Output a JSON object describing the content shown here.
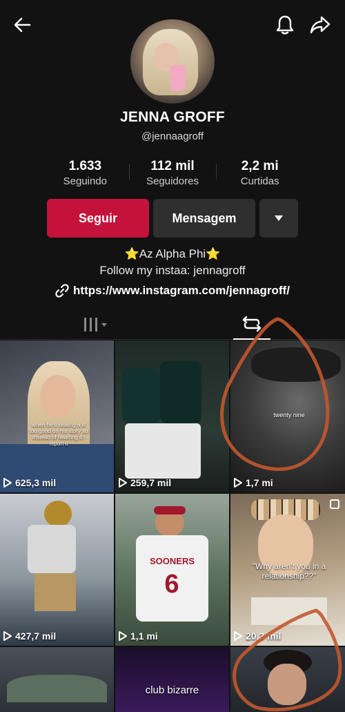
{
  "header": {
    "back_icon": "arrow-left-icon",
    "bell_icon": "bell-icon",
    "share_icon": "share-icon"
  },
  "profile": {
    "display_name": "JENNA GROFF",
    "username": "@jennaagroff",
    "stats": [
      {
        "value": "1.633",
        "label": "Seguindo"
      },
      {
        "value": "112 mil",
        "label": "Seguidores"
      },
      {
        "value": "2,2 mi",
        "label": "Curtidas"
      }
    ],
    "buttons": {
      "follow": "Seguir",
      "message": "Mensagem"
    },
    "bio_line1": "⭐Az Alpha Phi⭐",
    "bio_line2": "Follow my instaa: jennagroff",
    "link": "https://www.instagram.com/jennagroff/"
  },
  "tabs": {
    "grid_icon": "grid-icon",
    "repost_icon": "repost-icon"
  },
  "videos": [
    {
      "views": "625,3 mil",
      "caption": "when he's looking a lil too good on his story so instead of hearting it i report it"
    },
    {
      "views": "259,7 mil",
      "caption": ""
    },
    {
      "views": "1,7 mi",
      "caption": "twenty nine"
    },
    {
      "views": "427,7 mil",
      "caption": ""
    },
    {
      "views": "1,1 mi",
      "caption": "SOONERS"
    },
    {
      "views": "20,3 mil",
      "caption": "\"Why aren't you in a relationship??\""
    },
    {
      "views": "",
      "caption": ""
    },
    {
      "views": "",
      "caption": "club  bizarre"
    },
    {
      "views": "",
      "caption": ""
    }
  ],
  "colors": {
    "background": "#121212",
    "follow_button": "#c4133b",
    "secondary_button": "#2f2f2f",
    "annotation": "#c2582e"
  }
}
